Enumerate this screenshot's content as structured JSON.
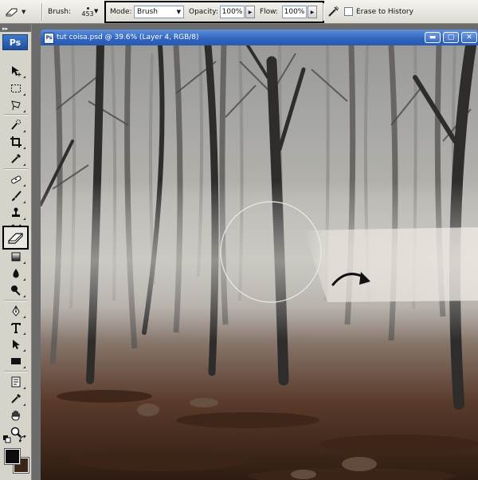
{
  "options_bar": {
    "tool_preset_icon": "eraser-icon",
    "brush_label": "Brush:",
    "brush_size": "453",
    "mode_label": "Mode:",
    "mode_value": "Brush",
    "opacity_label": "Opacity:",
    "opacity_value": "100%",
    "flow_label": "Flow:",
    "flow_value": "100%",
    "airbrush_icon": "airbrush-icon",
    "erase_to_history_label": "Erase to History",
    "erase_to_history_checked": false
  },
  "tools_panel": {
    "logo": "Ps",
    "selected_tool": "eraser-tool",
    "foreground_color": "#0d0d0d",
    "background_color": "#3a2517",
    "tools": [
      "move-tool",
      "marquee-tool",
      "lasso-tool",
      "quick-selection-tool",
      "crop-tool",
      "eyedropper-tool",
      "healing-brush-tool",
      "brush-tool",
      "clone-stamp-tool",
      "history-brush-tool",
      "eraser-tool",
      "gradient-tool",
      "blur-tool",
      "dodge-tool",
      "pen-tool",
      "type-tool",
      "path-selection-tool",
      "shape-tool",
      "notes-tool",
      "eyedropper-tool-2",
      "hand-tool",
      "zoom-tool"
    ]
  },
  "document": {
    "title": "tut coisa.psd @ 39.6% (Layer 4, RGB/8)",
    "window_buttons": [
      "minimize",
      "maximize",
      "close"
    ],
    "brush_cursor_icon": "circle-brush-cursor",
    "annotation_icon": "curved-arrow-icon"
  }
}
